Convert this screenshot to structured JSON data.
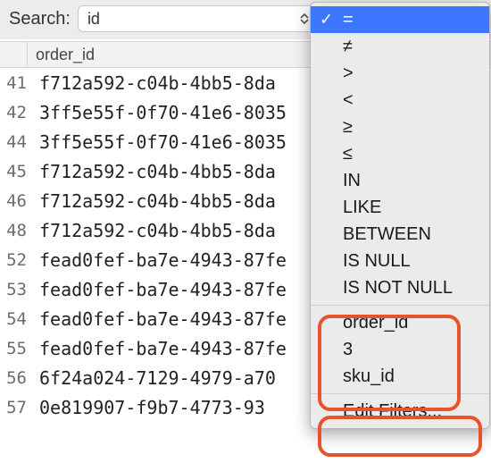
{
  "search": {
    "label": "Search:",
    "value": "id"
  },
  "column_header": "order_id",
  "rows": [
    {
      "n": "41",
      "v": "f712a592-c04b-4bb5-8da"
    },
    {
      "n": "42",
      "v": "3ff5e55f-0f70-41e6-8035"
    },
    {
      "n": "44",
      "v": "3ff5e55f-0f70-41e6-8035"
    },
    {
      "n": "45",
      "v": "f712a592-c04b-4bb5-8da"
    },
    {
      "n": "46",
      "v": "f712a592-c04b-4bb5-8da"
    },
    {
      "n": "48",
      "v": "f712a592-c04b-4bb5-8da"
    },
    {
      "n": "52",
      "v": "fead0fef-ba7e-4943-87fe"
    },
    {
      "n": "53",
      "v": "fead0fef-ba7e-4943-87fe"
    },
    {
      "n": "54",
      "v": "fead0fef-ba7e-4943-87fe"
    },
    {
      "n": "55",
      "v": "fead0fef-ba7e-4943-87fe"
    },
    {
      "n": "56",
      "v": "6f24a024-7129-4979-a70"
    },
    {
      "n": "57",
      "v": "0e819907-f9b7-4773-93"
    }
  ],
  "menu": {
    "selected_index": 0,
    "operators": [
      "=",
      "≠",
      ">",
      "<",
      "≥",
      "≤",
      "IN",
      "LIKE",
      "BETWEEN",
      "IS NULL",
      "IS NOT NULL"
    ],
    "extras": [
      "order_id",
      "3",
      "sku_id"
    ],
    "edit": "Edit Filters..."
  },
  "annotation_color": "#e9532c"
}
